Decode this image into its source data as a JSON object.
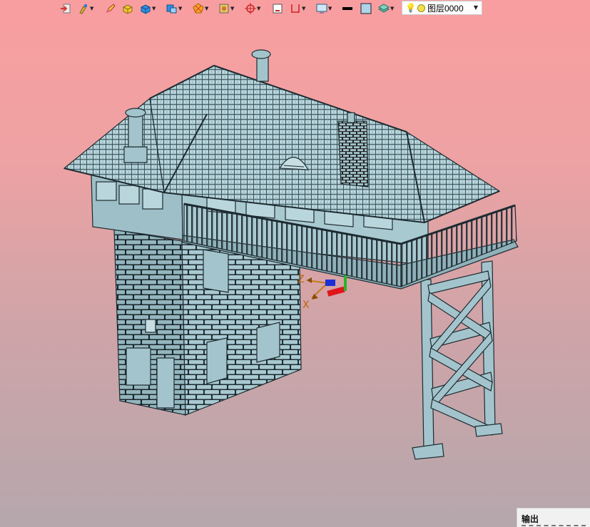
{
  "toolbar": {
    "items": [
      {
        "icon": "import-icon",
        "dropdown": false
      },
      {
        "icon": "paint-brush-icon",
        "dropdown": true
      },
      {
        "icon": "pencil-edit-icon",
        "dropdown": false
      },
      {
        "icon": "solid-box-yellow-icon",
        "dropdown": false
      },
      {
        "icon": "solid-box-blue-icon",
        "dropdown": true
      },
      {
        "icon": "view-orientation-icon",
        "dropdown": true
      },
      {
        "icon": "polygon-section-icon",
        "dropdown": true
      },
      {
        "icon": "render-style-icon",
        "dropdown": true
      },
      {
        "icon": "origin-crosshair-icon",
        "dropdown": true
      },
      {
        "icon": "frame-icon",
        "dropdown": false
      },
      {
        "icon": "dimension-icon",
        "dropdown": true
      },
      {
        "icon": "display-monitor-icon",
        "dropdown": true
      },
      {
        "icon": "line-color-icon",
        "dropdown": false
      },
      {
        "icon": "face-color-icon",
        "dropdown": false
      },
      {
        "icon": "layer-stack-icon",
        "dropdown": true
      }
    ],
    "layer": {
      "name": "图层0000"
    }
  },
  "triad": {
    "z_label": "Z",
    "x_label": "X"
  },
  "output_panel": {
    "title": "输出"
  },
  "colors": {
    "model": "#a3c4cc",
    "edge": "#1d2b30",
    "background_top": "#f99ea0",
    "background_bottom": "#b5a7ac"
  }
}
